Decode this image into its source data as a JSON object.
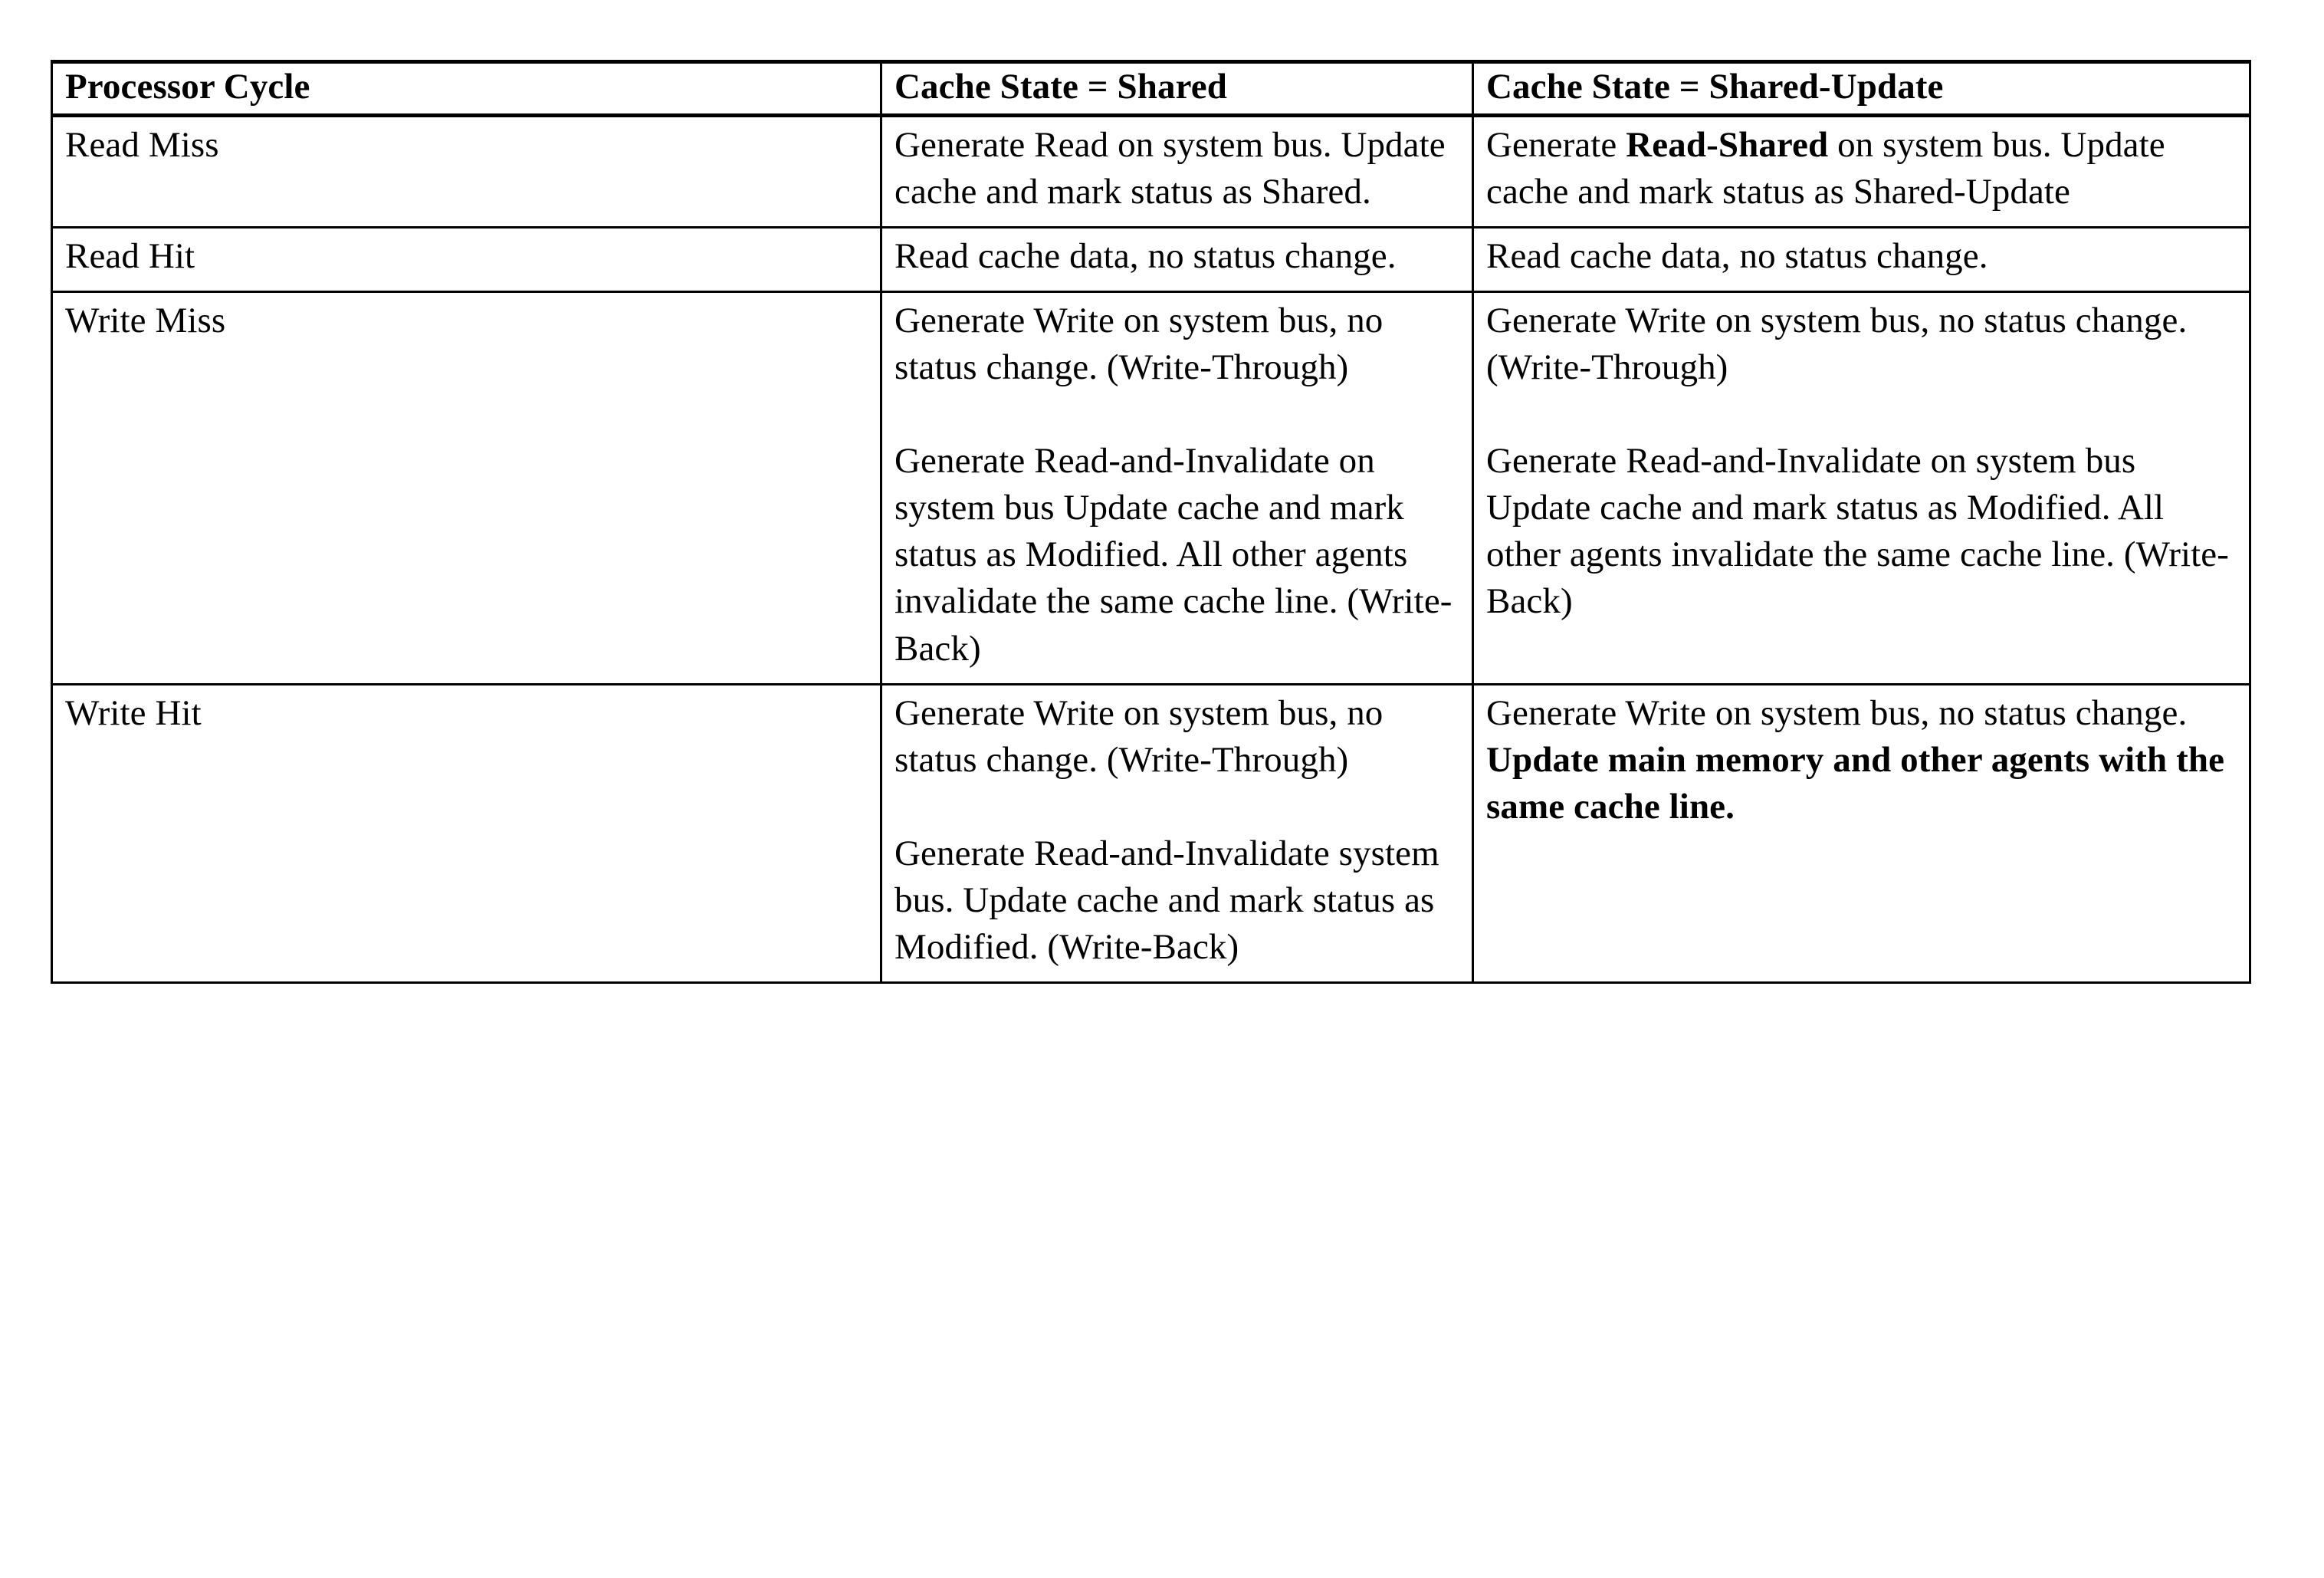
{
  "document": {
    "kind": "table",
    "title": "Cache coherency protocol state transition table",
    "background_color": "#ffffff",
    "text_color": "#000000"
  },
  "table": {
    "columns": [
      {
        "id": "processor_cycle",
        "header": "Processor Cycle"
      },
      {
        "id": "cache_state_shared",
        "header": "Cache State = Shared"
      },
      {
        "id": "cache_state_shared_update",
        "header": "Cache State = Shared-Update"
      }
    ],
    "rows": [
      {
        "label": "Read Miss",
        "shared": {
          "paragraphs": [
            {
              "runs": [
                {
                  "text": "Generate Read on system bus. Update cache and mark status as Shared.",
                  "bold": false
                }
              ]
            }
          ]
        },
        "shared_update": {
          "paragraphs": [
            {
              "runs": [
                {
                  "text": "Generate ",
                  "bold": false
                },
                {
                  "text": "Read-Shared",
                  "bold": true
                },
                {
                  "text": " on system bus. Update cache and mark status as Shared-Update",
                  "bold": false
                }
              ]
            }
          ]
        }
      },
      {
        "label": "Read Hit",
        "shared": {
          "paragraphs": [
            {
              "runs": [
                {
                  "text": "Read cache data, no status change.",
                  "bold": false
                }
              ]
            }
          ]
        },
        "shared_update": {
          "paragraphs": [
            {
              "runs": [
                {
                  "text": "Read cache data, no status change.",
                  "bold": false
                }
              ]
            }
          ]
        }
      },
      {
        "label": "Write Miss",
        "shared": {
          "paragraphs": [
            {
              "runs": [
                {
                  "text": "Generate Write on system bus, no status change. (Write-Through)",
                  "bold": false
                }
              ]
            },
            {
              "runs": [
                {
                  "text": "Generate Read-and-Invalidate on system bus Update cache and mark status as Modified.  All other agents invalidate the same cache line. (Write-Back)",
                  "bold": false
                }
              ]
            }
          ]
        },
        "shared_update": {
          "paragraphs": [
            {
              "runs": [
                {
                  "text": "Generate Write on system bus, no status change. (Write-Through)",
                  "bold": false
                }
              ]
            },
            {
              "runs": [
                {
                  "text": "Generate Read-and-Invalidate on system bus Update cache and mark status as Modified.  All other agents invalidate the same cache line. (Write-Back)",
                  "bold": false
                }
              ]
            }
          ]
        }
      },
      {
        "label": "Write Hit",
        "shared": {
          "paragraphs": [
            {
              "runs": [
                {
                  "text": "Generate Write on system bus, no status change. (Write-Through)",
                  "bold": false
                }
              ]
            },
            {
              "runs": [
                {
                  "text": "Generate Read-and-Invalidate system bus. Update cache and mark status as Modified. (Write-Back)",
                  "bold": false
                }
              ]
            }
          ]
        },
        "shared_update": {
          "paragraphs": [
            {
              "runs": [
                {
                  "text": "Generate Write on system bus, no status change.  ",
                  "bold": false
                },
                {
                  "text": "Update main memory and other agents with the same cache line.",
                  "bold": true
                }
              ]
            }
          ]
        }
      }
    ]
  }
}
